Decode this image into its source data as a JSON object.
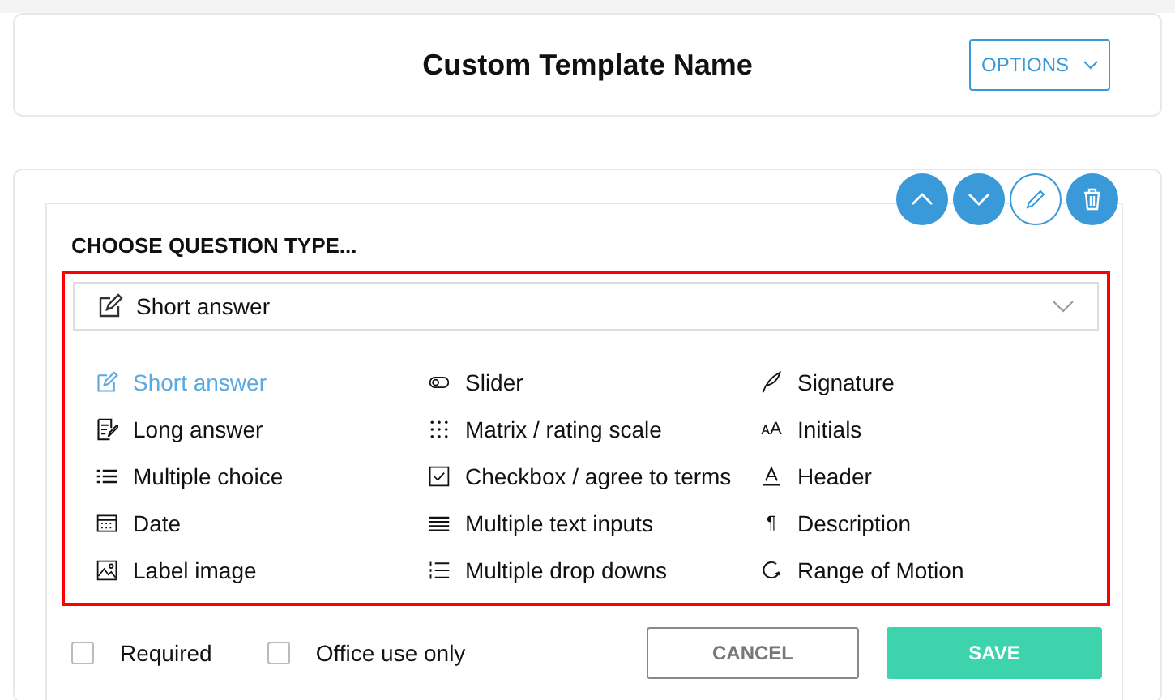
{
  "header": {
    "title": "Custom Template Name",
    "options_button": "OPTIONS"
  },
  "question": {
    "heading": "CHOOSE QUESTION TYPE...",
    "select": {
      "value": "Short answer",
      "kind": "short"
    },
    "types": [
      {
        "label": "Short answer",
        "kind": "short",
        "selected": true
      },
      {
        "label": "Long answer",
        "kind": "long",
        "selected": false
      },
      {
        "label": "Multiple choice",
        "kind": "multi",
        "selected": false
      },
      {
        "label": "Date",
        "kind": "date",
        "selected": false
      },
      {
        "label": "Label image",
        "kind": "image",
        "selected": false
      },
      {
        "label": "Slider",
        "kind": "slider",
        "selected": false
      },
      {
        "label": "Matrix / rating scale",
        "kind": "matrix",
        "selected": false
      },
      {
        "label": "Checkbox / agree to terms",
        "kind": "checkbox",
        "selected": false
      },
      {
        "label": "Multiple text inputs",
        "kind": "textinputs",
        "selected": false
      },
      {
        "label": "Multiple drop downs",
        "kind": "dropdowns",
        "selected": false
      },
      {
        "label": "Signature",
        "kind": "signature",
        "selected": false
      },
      {
        "label": "Initials",
        "kind": "glyph",
        "glyph": "ᴀA",
        "selected": false
      },
      {
        "label": "Header",
        "kind": "header",
        "selected": false
      },
      {
        "label": "Description",
        "kind": "glyph",
        "glyph": "¶",
        "selected": false
      },
      {
        "label": "Range of Motion",
        "kind": "motion",
        "selected": false
      }
    ],
    "options": [
      {
        "label": "Required",
        "checked": false
      },
      {
        "label": "Office use only",
        "checked": false
      }
    ],
    "buttons": {
      "cancel": "CANCEL",
      "save": "SAVE"
    }
  }
}
